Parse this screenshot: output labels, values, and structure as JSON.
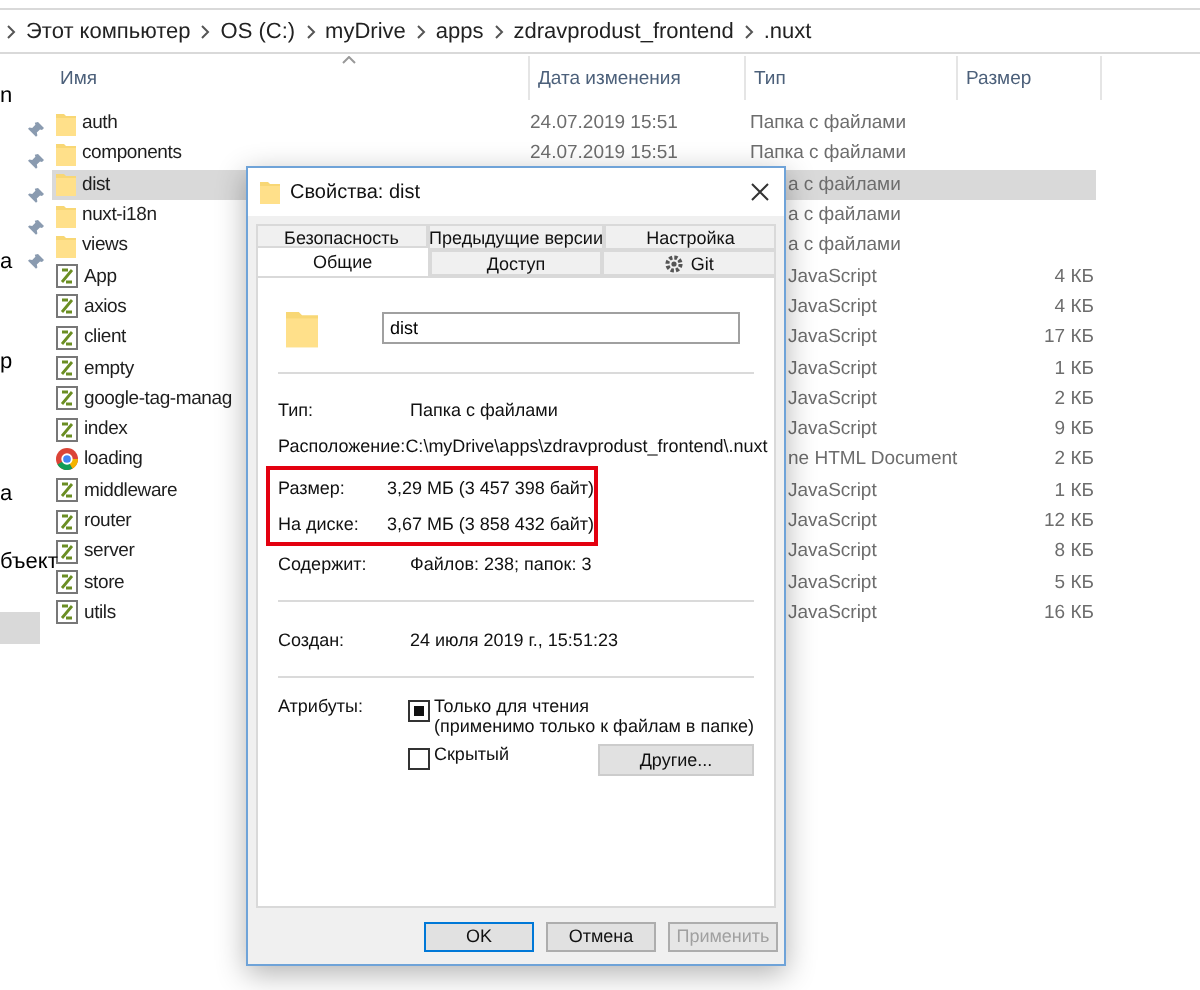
{
  "address_bar": {
    "crumbs": [
      "Этот компьютер",
      "OS (C:)",
      "myDrive",
      "apps",
      "zdravprodust_frontend",
      ".nuxt"
    ]
  },
  "nav_pane": {
    "items": [
      {
        "label": "n",
        "pinned": false,
        "selected": false
      },
      {
        "pinned": true,
        "selected": false
      },
      {
        "pinned": true,
        "selected": false
      },
      {
        "pinned": true,
        "selected": false
      },
      {
        "pinned": true,
        "selected": false
      },
      {
        "label": "а",
        "pinned": true,
        "selected": false
      },
      {
        "pinned": false,
        "selected": false
      },
      {
        "pinned": false,
        "selected": false
      },
      {
        "label": "р",
        "pinned": false,
        "selected": false
      },
      {
        "pinned": false,
        "selected": false
      },
      {
        "pinned": false,
        "selected": false
      },
      {
        "pinned": false,
        "selected": false
      },
      {
        "label": "а",
        "pinned": false,
        "selected": false
      },
      {
        "pinned": false,
        "selected": false
      },
      {
        "label": "бъект",
        "pinned": false,
        "selected": false
      },
      {
        "pinned": false,
        "selected": false
      },
      {
        "pinned": false,
        "selected": true
      }
    ]
  },
  "file_list": {
    "columns": [
      "Имя",
      "Дата изменения",
      "Тип",
      "Размер"
    ],
    "rows": [
      {
        "kind": "folder",
        "name": "auth",
        "date": "24.07.2019 15:51",
        "type": "Папка с файлами",
        "selected": false
      },
      {
        "kind": "folder",
        "name": "components",
        "date": "24.07.2019 15:51",
        "type": "Папка с файлами",
        "selected": false
      },
      {
        "kind": "folder",
        "name": "dist",
        "type": "а с файлами",
        "selected": true
      },
      {
        "kind": "folder",
        "name": "nuxt-i18n",
        "type": "а с файлами",
        "selected": false
      },
      {
        "kind": "folder",
        "name": "views",
        "type": "а с файлами",
        "selected": false
      },
      {
        "kind": "script",
        "name": "App",
        "type": "JavaScript",
        "size": "4 КБ",
        "selected": false
      },
      {
        "kind": "script",
        "name": "axios",
        "type": "JavaScript",
        "size": "4 КБ",
        "selected": false
      },
      {
        "kind": "script",
        "name": "client",
        "type": "JavaScript",
        "size": "17 КБ",
        "selected": false
      },
      {
        "kind": "script",
        "name": "empty",
        "type": "JavaScript",
        "size": "1 КБ",
        "selected": false
      },
      {
        "kind": "script",
        "name": "google-tag-manag",
        "type": "JavaScript",
        "size": "2 КБ",
        "selected": false
      },
      {
        "kind": "script",
        "name": "index",
        "type": "JavaScript",
        "size": "9 КБ",
        "selected": false
      },
      {
        "kind": "web",
        "name": "loading",
        "type": "ne HTML Document",
        "size": "2 КБ",
        "selected": false
      },
      {
        "kind": "script",
        "name": "middleware",
        "type": "JavaScript",
        "size": "1 КБ",
        "selected": false
      },
      {
        "kind": "script",
        "name": "router",
        "type": "JavaScript",
        "size": "12 КБ",
        "selected": false
      },
      {
        "kind": "script",
        "name": "server",
        "type": "JavaScript",
        "size": "8 КБ",
        "selected": false
      },
      {
        "kind": "script",
        "name": "store",
        "type": "JavaScript",
        "size": "5 КБ",
        "selected": false
      },
      {
        "kind": "script",
        "name": "utils",
        "type": "JavaScript",
        "size": "16 КБ",
        "selected": false
      }
    ]
  },
  "dialog": {
    "title": "Свойства: dist",
    "tab_rows": [
      [
        {
          "kind": "plain",
          "label": "Безопасность",
          "selected": false
        },
        {
          "kind": "plain",
          "label": "Предыдущие версии",
          "selected": false
        },
        {
          "kind": "plain",
          "label": "Настройка",
          "selected": false
        }
      ],
      [
        {
          "kind": "plain",
          "label": "Общие",
          "selected": true
        },
        {
          "kind": "plain",
          "label": "Доступ",
          "selected": false
        },
        {
          "kind": "icon",
          "label": "Git",
          "selected": false
        }
      ]
    ],
    "name_field": {
      "value": "dist"
    },
    "sections": [
      [
        {
          "label": "Тип:",
          "value": "Папка с файлами",
          "highlighted": false
        },
        {
          "label": "Расположение:",
          "value": "C:\\myDrive\\apps\\zdravprodust_frontend\\.nuxt",
          "highlighted": false
        },
        {
          "label": "Размер:",
          "value": "3,29 МБ (3 457 398 байт)",
          "highlighted": true
        },
        {
          "label": "На диске:",
          "value": "3,67 МБ (3 858 432 байт)",
          "highlighted": true
        },
        {
          "label": "Содержит:",
          "value": "Файлов: 238; папок: 3",
          "highlighted": false
        }
      ],
      [
        {
          "label": "Создан:",
          "value": "24 июля 2019 г., 15:51:23",
          "highlighted": false
        }
      ]
    ],
    "attributes": {
      "label": "Атрибуты:",
      "checkboxes": [
        {
          "label": "Только для чтения",
          "note": "(применимо только к файлам в папке)",
          "checked": true
        },
        {
          "label": "Скрытый",
          "checked": false
        }
      ],
      "button": "Другие..."
    },
    "buttons": [
      {
        "label": "OK",
        "default": true,
        "disabled": false
      },
      {
        "label": "Отмена",
        "default": false,
        "disabled": false
      },
      {
        "label": "Применить",
        "default": false,
        "disabled": true
      }
    ]
  }
}
